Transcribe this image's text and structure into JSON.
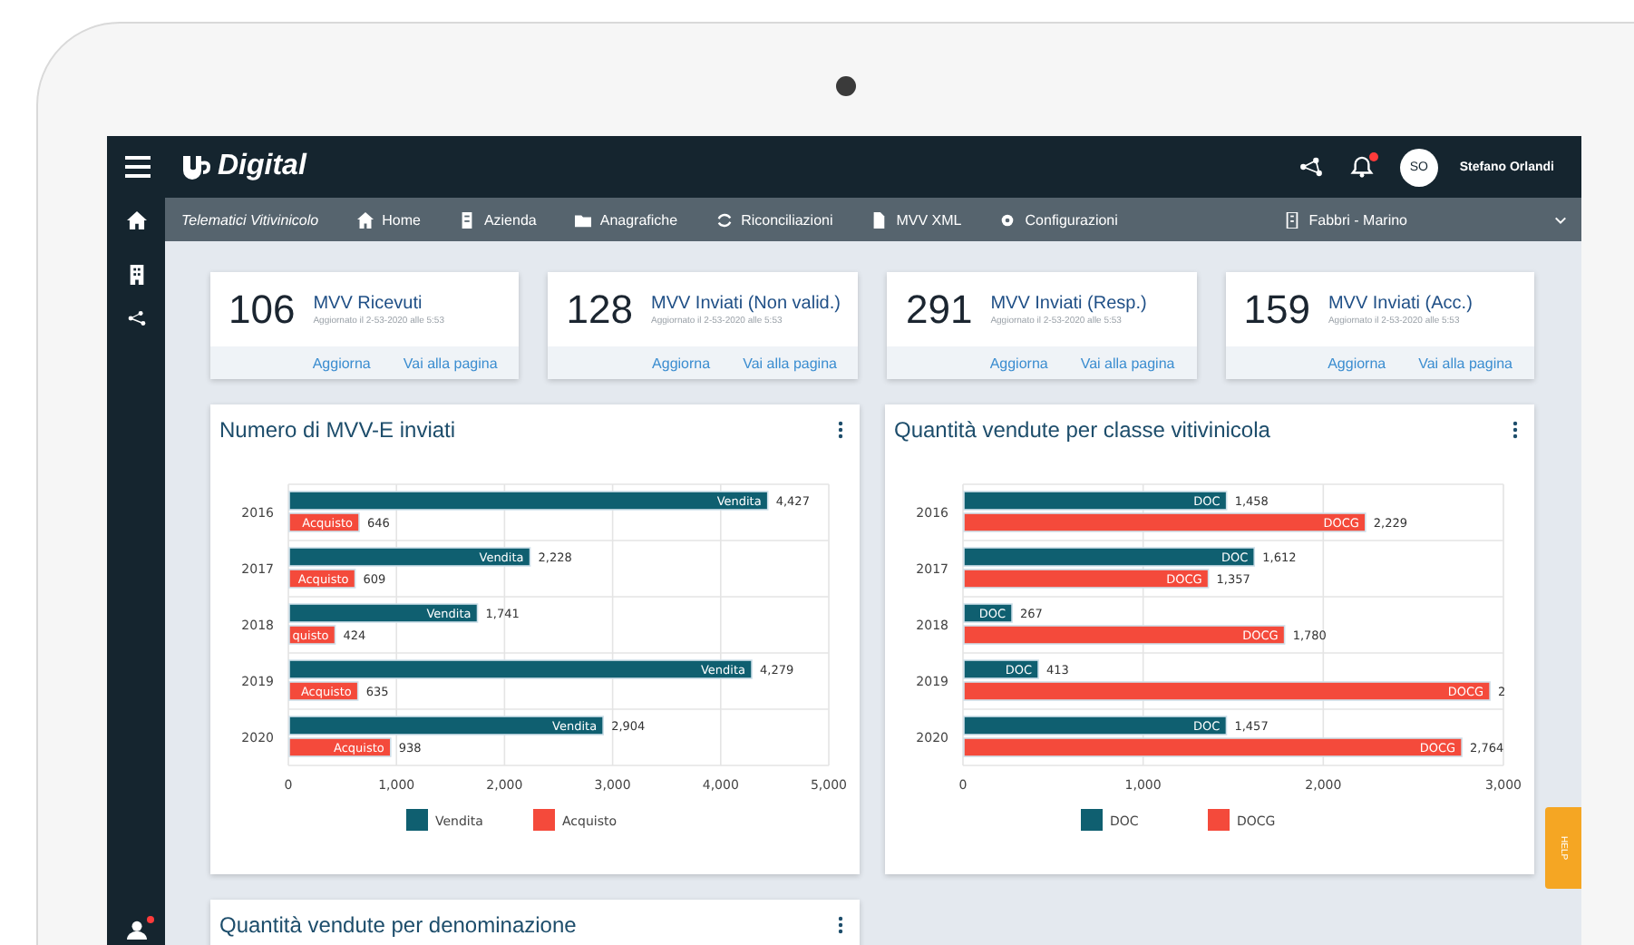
{
  "brand": {
    "name": "Digital"
  },
  "topbar": {
    "notifications_unread": true,
    "user": {
      "initials": "SO",
      "name": "Stefano Orlandi"
    }
  },
  "sidebar": {
    "footer_alert": true
  },
  "subnav": {
    "section": "Telematici Vitivinicolo",
    "items": [
      {
        "label": "Home"
      },
      {
        "label": "Azienda"
      },
      {
        "label": "Anagrafiche"
      },
      {
        "label": "Riconciliazioni"
      },
      {
        "label": "MVV XML"
      },
      {
        "label": "Configurazioni"
      }
    ],
    "company": "Fabbri - Marino"
  },
  "stats": [
    {
      "value": "106",
      "title": "MVV Ricevuti",
      "updated": "Aggiornato il 2-53-2020 alle 5:53",
      "actions": [
        "Aggiorna",
        "Vai alla pagina"
      ]
    },
    {
      "value": "128",
      "title": "MVV Inviati (Non valid.)",
      "updated": "Aggiornato il 2-53-2020 alle 5:53",
      "actions": [
        "Aggiorna",
        "Vai alla pagina"
      ]
    },
    {
      "value": "291",
      "title": "MVV Inviati (Resp.)",
      "updated": "Aggiornato il 2-53-2020 alle 5:53",
      "actions": [
        "Aggiorna",
        "Vai alla pagina"
      ]
    },
    {
      "value": "159",
      "title": "MVV Inviati (Acc.)",
      "updated": "Aggiornato il 2-53-2020 alle 5:53",
      "actions": [
        "Aggiorna",
        "Vai alla pagina"
      ]
    }
  ],
  "panels": [
    {
      "title": "Numero di MVV-E inviati",
      "chart_data": {
        "type": "bar",
        "orientation": "horizontal",
        "categories": [
          "2016",
          "2017",
          "2018",
          "2019",
          "2020"
        ],
        "xlim": [
          0,
          5000
        ],
        "xticks": [
          {
            "value": 0,
            "label": "0"
          },
          {
            "value": 1000,
            "label": "1,000"
          },
          {
            "value": 2000,
            "label": "2,000"
          },
          {
            "value": 3000,
            "label": "3,000"
          },
          {
            "value": 4000,
            "label": "4,000"
          },
          {
            "value": 5000,
            "label": "5,000"
          }
        ],
        "data_labels": true,
        "series": [
          {
            "name": "Vendita",
            "color": "#0f5f70",
            "values": [
              4427,
              2228,
              1741,
              4279,
              2904
            ],
            "value_labels": [
              "4,427",
              "2,228",
              "1,741",
              "4,279",
              "2,904"
            ]
          },
          {
            "name": "Acquisto",
            "color": "#f44a3b",
            "values": [
              646,
              609,
              424,
              635,
              938
            ],
            "value_labels": [
              "646",
              "609",
              "424",
              "635",
              "938"
            ]
          }
        ],
        "annotations": [
          {
            "x": 424,
            "y": "2018",
            "text": "quisto"
          }
        ],
        "grid": true,
        "legend": true
      }
    },
    {
      "title": "Quantità vendute per classe vitivinicola",
      "chart_data": {
        "type": "bar",
        "orientation": "horizontal",
        "categories": [
          "2016",
          "2017",
          "2018",
          "2019",
          "2020"
        ],
        "xlim": [
          0,
          3000
        ],
        "xticks": [
          {
            "value": 0,
            "label": "0"
          },
          {
            "value": 1000,
            "label": "1,000"
          },
          {
            "value": 2000,
            "label": "2,000"
          },
          {
            "value": 3000,
            "label": "3,000"
          }
        ],
        "data_labels": true,
        "series": [
          {
            "name": "DOC",
            "color": "#0f5f70",
            "values": [
              1458,
              1612,
              267,
              413,
              1457
            ],
            "value_labels": [
              "1,458",
              "1,612",
              "267",
              "413",
              "1,457"
            ]
          },
          {
            "name": "DOCG",
            "color": "#f44a3b",
            "values": [
              2229,
              1357,
              1780,
              2920,
              2764
            ],
            "value_labels": [
              "2,229",
              "1,357",
              "1,780",
              null,
              "2,764"
            ]
          }
        ],
        "annotations": [
          {
            "x": 2920,
            "y": "2019",
            "text": "2"
          }
        ],
        "grid": true,
        "legend": true
      }
    },
    {
      "title": "Quantità vendute per denominazione"
    }
  ],
  "help": "HELP"
}
